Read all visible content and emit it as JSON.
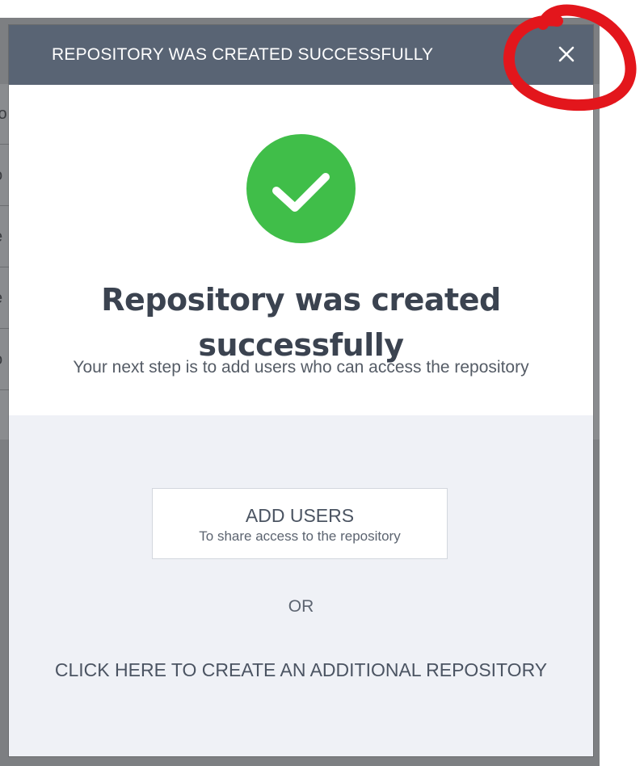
{
  "background": {
    "row_fragments": [
      "to",
      "o",
      "e",
      "e",
      "o"
    ]
  },
  "modal": {
    "title": "REPOSITORY WAS CREATED SUCCESSFULLY",
    "close_icon": "close-icon",
    "success_icon": "checkmark-circle-icon",
    "heading": "Repository was created successfully",
    "subtext": "Your next step is to add users who can access the repository",
    "add_users": {
      "label": "ADD USERS",
      "sublabel": "To share access to the repository"
    },
    "or_text": "OR",
    "create_link": "CLICK HERE TO CREATE AN ADDITIONAL REPOSITORY"
  },
  "colors": {
    "header_bg": "#596474",
    "success_green": "#40be49",
    "annotation_red": "#e3161c",
    "lower_panel_bg": "#eff1f6"
  }
}
